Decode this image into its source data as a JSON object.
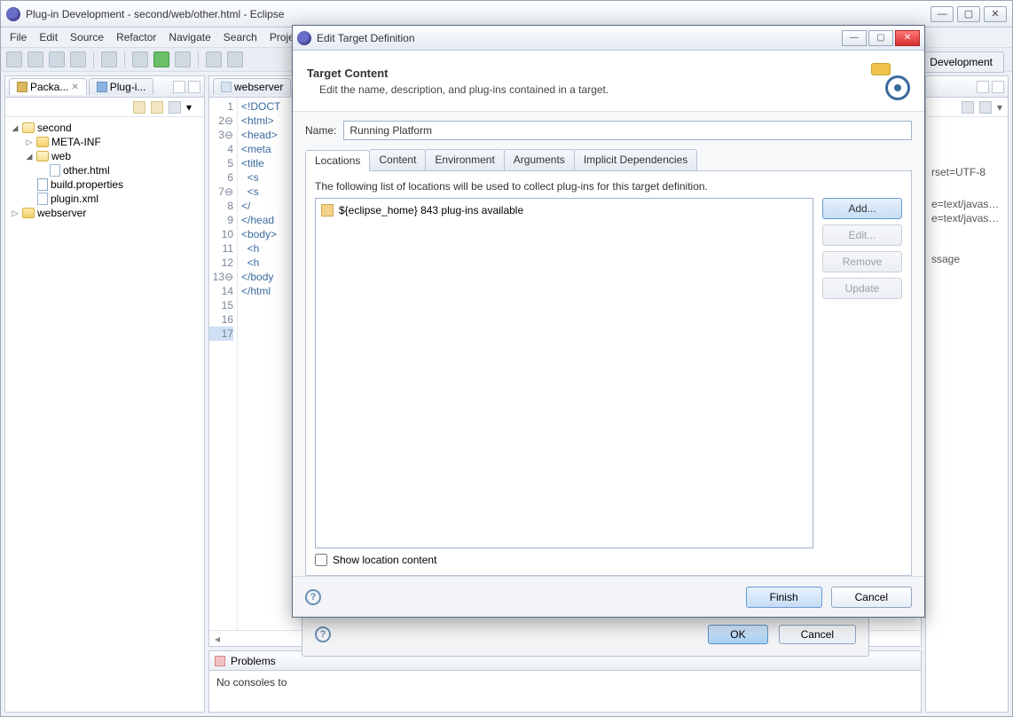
{
  "main": {
    "title": "Plug-in Development - second/web/other.html - Eclipse",
    "menus": [
      "File",
      "Edit",
      "Source",
      "Refactor",
      "Navigate",
      "Search",
      "Project"
    ],
    "perspective_tab": "Development"
  },
  "package_explorer": {
    "tab1": "Packa...",
    "tab2": "Plug-i...",
    "root": "second",
    "meta_inf": "META-INF",
    "web": "web",
    "other_html": "other.html",
    "build_props": "build.properties",
    "plugin_xml": "plugin.xml",
    "webserver": "webserver"
  },
  "editor": {
    "tab": "webserver",
    "lines": {
      "l1": "<!DOCT",
      "l2": "<html>",
      "l3": "<head>",
      "l4": "<meta",
      "l5": "<title",
      "l6": "  <s",
      "l7": "  <s",
      "l8": "",
      "l9": "",
      "l10": "",
      "l11": "</",
      "l12": "</head",
      "l13": "<body>",
      "l14": "  <h",
      "l15": "  <h",
      "l16": "</body",
      "l17": "</html"
    }
  },
  "problems": {
    "tab": "Problems",
    "msg": "No consoles to"
  },
  "outline": {
    "i1": "rset=UTF-8",
    "i2": "e=text/javascrip",
    "i3": "e=text/javascrip",
    "i4": "ssage"
  },
  "under_dialog": {
    "ok": "OK",
    "cancel": "Cancel"
  },
  "dialog": {
    "title": "Edit Target Definition",
    "header": "Target Content",
    "subtext": "Edit the name, description, and plug-ins contained in a target.",
    "name_label": "Name:",
    "name_value": "Running Platform",
    "tabs": {
      "locations": "Locations",
      "content": "Content",
      "environment": "Environment",
      "arguments": "Arguments",
      "implicit": "Implicit Dependencies"
    },
    "tab_desc": "The following list of locations will be used to collect plug-ins for this target definition.",
    "location_item": "${eclipse_home} 843 plug-ins available",
    "buttons": {
      "add": "Add...",
      "edit": "Edit...",
      "remove": "Remove",
      "update": "Update"
    },
    "show_loc": "Show location content",
    "finish": "Finish",
    "cancel": "Cancel"
  }
}
